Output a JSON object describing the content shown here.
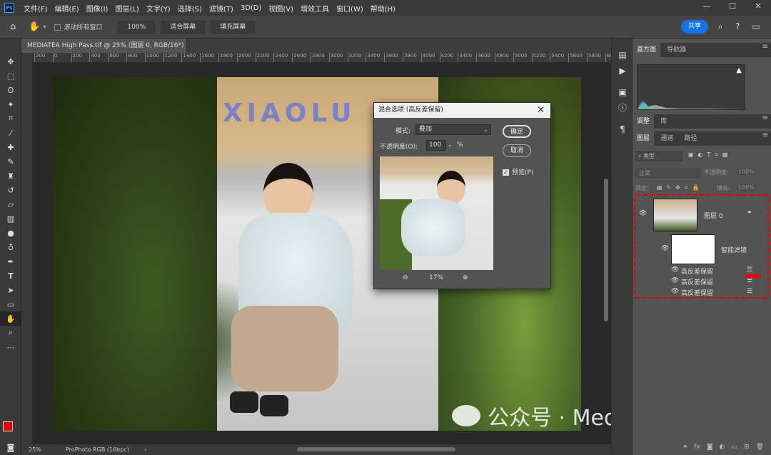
{
  "menubar": {
    "logo": "Ps",
    "items": [
      "文件(F)",
      "编辑(E)",
      "图像(I)",
      "图层(L)",
      "文字(Y)",
      "选择(S)",
      "滤镜(T)",
      "3D(D)",
      "视图(V)",
      "增效工具",
      "窗口(W)",
      "帮助(H)"
    ],
    "win_min": "—",
    "win_max": "☐",
    "win_close": "✕"
  },
  "optbar": {
    "scroll_all_label": "滚动所有窗口",
    "zoom_100": "100%",
    "fit_screen": "适合屏幕",
    "fill_screen": "填充屏幕",
    "share": "共享"
  },
  "document": {
    "tab_title": "MEDIATEA High Pass.tif @ 25% (图层 0, RGB/16*) *",
    "tab_close": "×",
    "ruler_ticks": [
      "200",
      "0",
      "200",
      "400",
      "600",
      "800",
      "1000",
      "1200",
      "1400",
      "1600",
      "1800",
      "2000",
      "2200",
      "2400",
      "2600",
      "2800",
      "3000",
      "3200",
      "3400",
      "3600",
      "3800",
      "4000",
      "4200",
      "4400",
      "4600",
      "4800",
      "5000",
      "5200",
      "5400",
      "5600",
      "5800",
      "6000",
      "6200"
    ],
    "wall_text": "LUXIAOLU"
  },
  "statusbar": {
    "zoom": "25%",
    "color_profile": "ProPhoto RGB (16bpc)"
  },
  "watermark": {
    "text": "公众号 · MediaTea"
  },
  "dialog": {
    "title": "混合选项 (高反差保留)",
    "close": "✕",
    "mode_label": "模式:",
    "mode_value": "叠加",
    "opacity_label": "不透明度(O):",
    "opacity_value": "100",
    "opacity_unit": "%",
    "ok": "确定",
    "cancel": "取消",
    "preview_label": "预览(P)",
    "zoom_out": "⊖",
    "zoom_value": "17%",
    "zoom_in": "⊕"
  },
  "panels": {
    "top_tabs": [
      "直方图",
      "导航器"
    ],
    "mid_tabs": [
      "调整",
      "库"
    ],
    "layer_tabs": [
      "图层",
      "通道",
      "路径"
    ],
    "search_placeholder": "类型",
    "blend_mode": "正常",
    "opacity_label": "不透明度:",
    "opacity_value": "100%",
    "lock_label": "锁定:",
    "fill_label": "填充:",
    "fill_value": "100%",
    "layer_name": "图层 0",
    "smart_filters": "智能滤镜",
    "filters": [
      "高反差保留",
      "高反差保留",
      "高反差保留"
    ]
  },
  "colors": {
    "accent": "#1473e6",
    "foreground": "#e20000",
    "background": "#000000",
    "annotation": "#e00000"
  }
}
